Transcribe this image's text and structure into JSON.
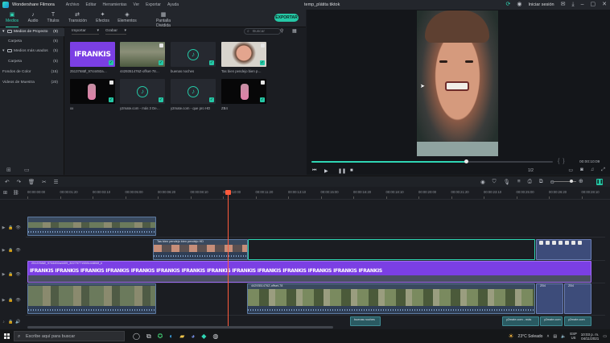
{
  "titlebar": {
    "app_name": "Wondershare Filmora",
    "menu": [
      "Archivo",
      "Editar",
      "Herramientas",
      "Ver",
      "Exportar",
      "Ayuda"
    ],
    "project": "temp_plátita tiktok",
    "login": "Iniciar sesión"
  },
  "toolbar": {
    "tabs": [
      {
        "label": "Medios",
        "icon": "folder-icon",
        "glyph": "▣"
      },
      {
        "label": "Audio",
        "icon": "music-note-icon",
        "glyph": "♪"
      },
      {
        "label": "Títulos",
        "icon": "text-icon",
        "glyph": "T"
      },
      {
        "label": "Transición",
        "icon": "transition-icon",
        "glyph": "⇄"
      },
      {
        "label": "Efectos",
        "icon": "effects-icon",
        "glyph": "✦"
      },
      {
        "label": "Elementos",
        "icon": "elements-icon",
        "glyph": "◈"
      },
      {
        "label": "Pantalla Dividida",
        "icon": "split-screen-icon",
        "glyph": "▦"
      }
    ],
    "export_label": "EXPORTAR"
  },
  "sidebar": {
    "items": [
      {
        "label": "Medios de Proyecto",
        "count": "(9)",
        "kind": "header"
      },
      {
        "label": "Carpeta",
        "count": "(6)",
        "kind": "child"
      },
      {
        "label": "Medios más usados",
        "count": "(5)",
        "kind": "header"
      },
      {
        "label": "Carpeta",
        "count": "(5)",
        "kind": "child"
      },
      {
        "label": "Fondos de Color",
        "count": "(15)",
        "kind": "plain"
      },
      {
        "label": "Videos de Muestra",
        "count": "(20)",
        "kind": "plain"
      }
    ]
  },
  "media": {
    "import_label": "Importar",
    "record_label": "Grabar",
    "search_placeholder": "Buscar",
    "items": [
      {
        "caption": "2513768Ø_9744492a…",
        "type": "twitch"
      },
      {
        "caption": "4429351476Z-offset-78…",
        "type": "street"
      },
      {
        "caption": "buenas noches",
        "type": "music"
      },
      {
        "caption": "Tas bien pendejo bien p…",
        "type": "face"
      },
      {
        "caption": "xx",
        "type": "dark"
      },
      {
        "caption": "y2mate.com - más 3 De…",
        "type": "music"
      },
      {
        "caption": "y2mate.com - que pro HD",
        "type": "music"
      },
      {
        "caption": "ZB4",
        "type": "dark"
      }
    ],
    "twitch_word": "IFRANKIS"
  },
  "preview": {
    "timecode": "00:00:10:09",
    "quality": "1/2",
    "progress": 0.64
  },
  "ruler": {
    "ticks": [
      "00:00:00:00",
      "00:00:01:20",
      "00:00:03:10",
      "00:00:05:00",
      "00:00:06:20",
      "00:00:08:10",
      "00:00:10:00",
      "00:00:11:20",
      "00:00:13:10",
      "00:00:15:00",
      "00:00:16:20",
      "00:00:18:10",
      "00:00:20:00",
      "00:00:21:20",
      "00:00:23:10",
      "00:00:25:00",
      "00:00:26:20",
      "00:00:28:10"
    ]
  },
  "timeline": {
    "clip_labels": {
      "video_top": "",
      "selected": "Tas bien pendejo bien pendejo HD",
      "twitch": "2513768Ø_9744492a4409_3227977192814480Ø_n",
      "bottom_video": "4429351476Z-offset-78",
      "img1": "ZB4",
      "img2": "ZB4",
      "audio1": "buenas noches",
      "audio2": "y2mate.com - más",
      "audio3": "y2mate.com"
    }
  },
  "taskbar": {
    "search_placeholder": "Escribe aquí para buscar",
    "weather": "23°C  Soleado",
    "lang_top": "ESP",
    "lang_bottom": "US",
    "time": "10:03 p. m.",
    "date": "04/11/2021"
  }
}
